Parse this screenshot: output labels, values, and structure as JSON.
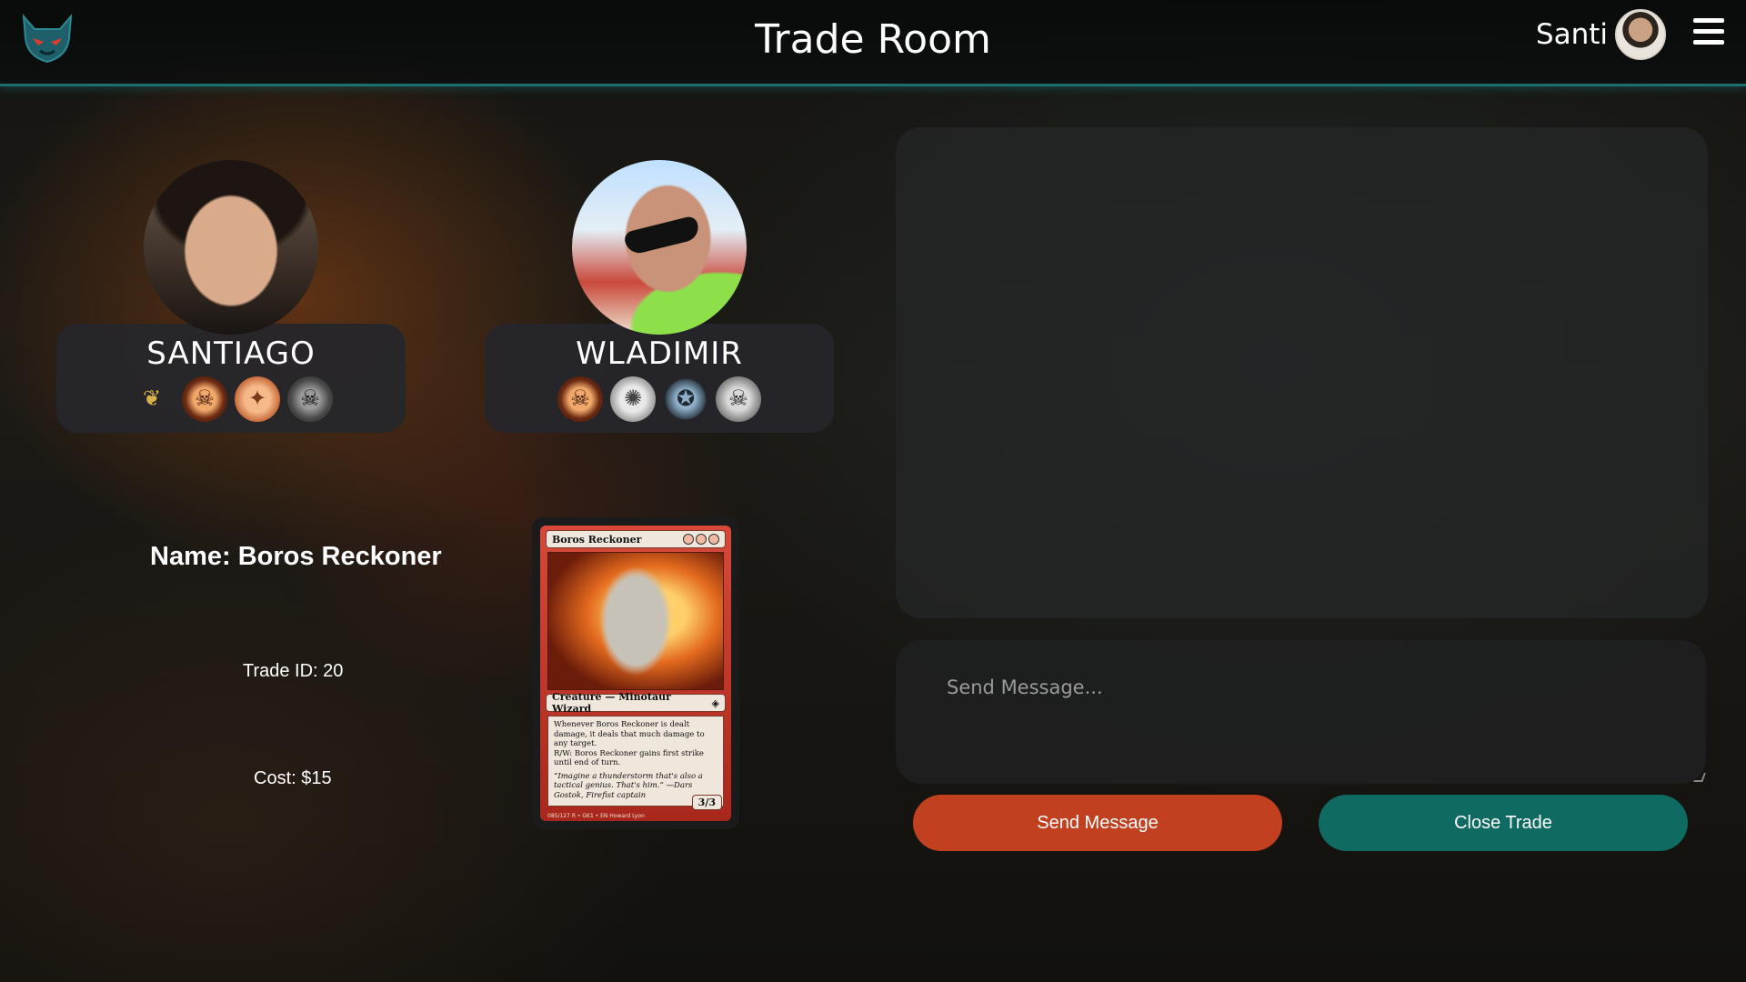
{
  "header": {
    "title": "Trade Room",
    "user_name": "Santi",
    "logo_icon": "demon-mask-logo",
    "menu_icon": "hamburger-menu-icon"
  },
  "profiles": [
    {
      "name": "SANTIAGO",
      "badges": [
        "eagle-badge",
        "demon-badge",
        "bronze-coin-badge",
        "dark-skull-badge"
      ]
    },
    {
      "name": "WLADIMIR",
      "badges": [
        "demon-badge",
        "silver-coin-badge",
        "medal-badge",
        "silver-skull-badge"
      ]
    }
  ],
  "trade": {
    "card_name_label": "Name: Boros Reckoner",
    "trade_id_label": "Trade ID: 20",
    "cost_label": "Cost: $15"
  },
  "card": {
    "title": "Boros Reckoner",
    "type_line": "Creature — Minotaur Wizard",
    "rules_text": "Whenever Boros Reckoner is dealt damage, it deals that much damage to any target.",
    "ability_text": "R/W: Boros Reckoner gains first strike until end of turn.",
    "flavor_text": "“Imagine a thunderstorm that's also a tactical genius. That's him.” —Dars Gostok, Firefist captain",
    "power_toughness": "3/3",
    "footer": "085/127 R • GK1 • EN  Howard Lyon"
  },
  "chat": {
    "input_placeholder": "Send Message...",
    "send_button": "Send Message",
    "close_button": "Close Trade"
  },
  "colors": {
    "accent_teal": "#1d6e6e",
    "send_button": "#c1401f",
    "close_button": "#0f6a62"
  }
}
